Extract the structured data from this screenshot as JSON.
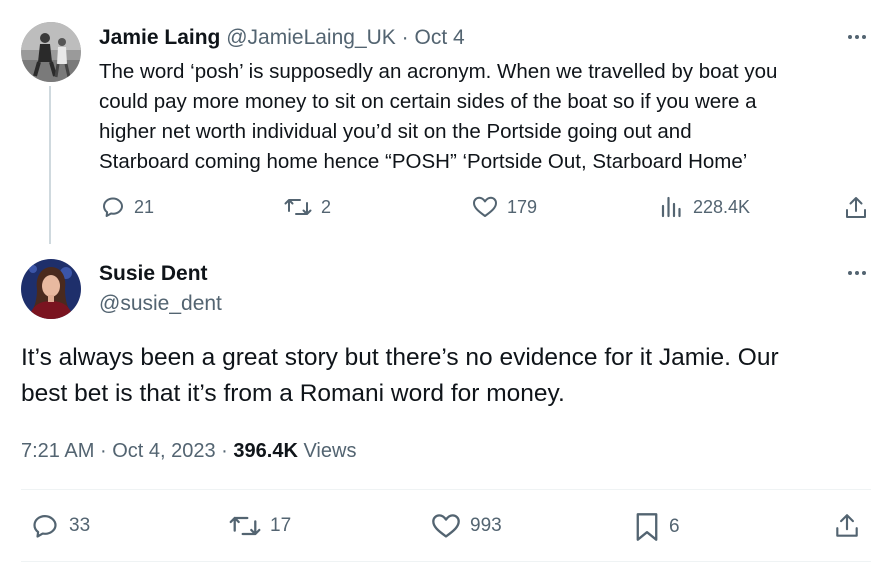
{
  "parent_tweet": {
    "author_name": "Jamie Laing",
    "author_handle": "@JamieLaing_UK",
    "separator": "·",
    "date": "Oct 4",
    "text_lines": [
      "The word ‘posh’ is supposedly an acronym. When we travelled by boat you",
      "could pay more money to sit on certain sides of the boat so if you were a",
      "higher net worth individual you’d sit on the Portside going out and",
      "Starboard coming home hence “POSH” ‘Portside Out, Starboard Home’"
    ],
    "actions": {
      "replies": "21",
      "reposts": "2",
      "likes": "179",
      "views": "228.4K"
    }
  },
  "reply_tweet": {
    "author_name": "Susie Dent",
    "author_handle": "@susie_dent",
    "text_lines": [
      "It’s always been a great story but there’s no evidence for it Jamie. Our",
      "best bet is that it’s from a Romani word for money."
    ],
    "time": "7:21 AM",
    "separator": "·",
    "date": "Oct 4, 2023",
    "views_count": "396.4K",
    "views_label": "Views",
    "actions": {
      "replies": "33",
      "reposts": "17",
      "likes": "993",
      "bookmarks": "6"
    }
  },
  "icons": {
    "more": "more-horizontal-icon",
    "reply": "reply-icon",
    "repost": "repost-icon",
    "like": "heart-icon",
    "views": "analytics-icon",
    "bookmark": "bookmark-icon",
    "share": "share-icon"
  },
  "colors": {
    "text_primary": "#0f1419",
    "text_secondary": "#536471",
    "thread_line": "#cfd9de",
    "divider": "#eff3f4"
  }
}
